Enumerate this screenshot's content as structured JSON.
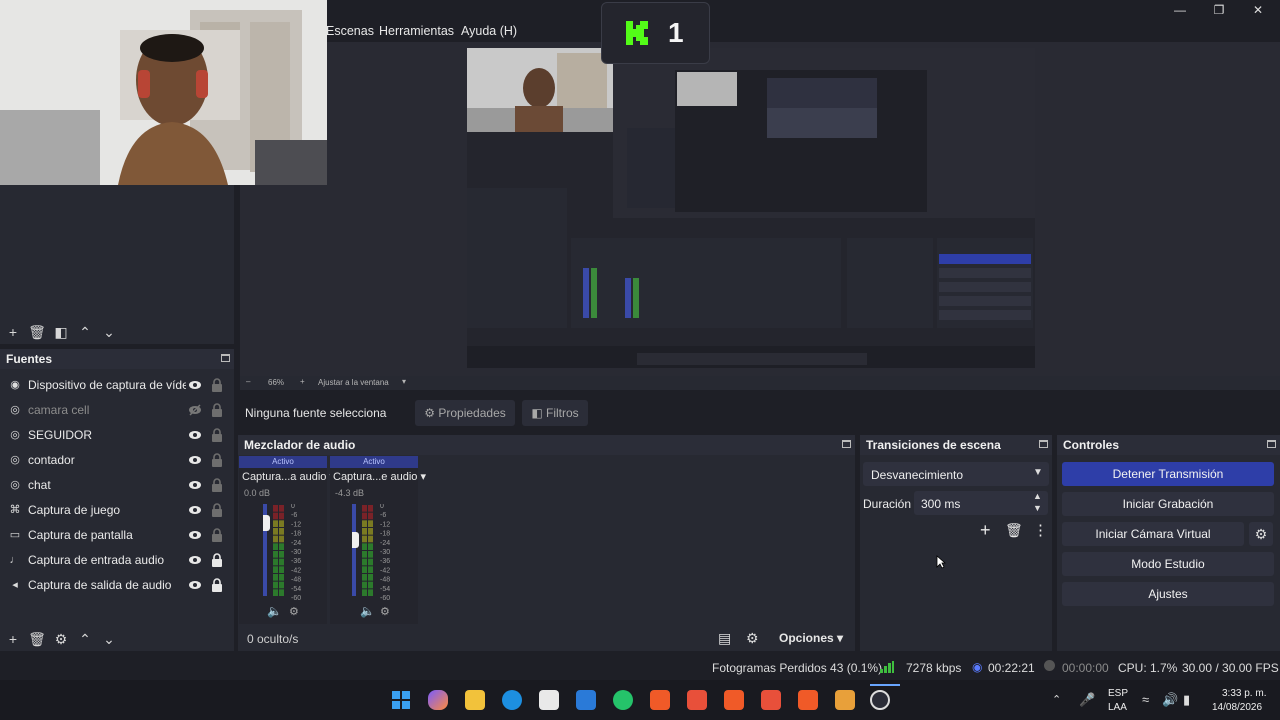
{
  "menu": {
    "items": [
      "Escenas",
      "Herramientas",
      "Ayuda (H)"
    ]
  },
  "overlay": {
    "k1_text": "1"
  },
  "preview": {
    "zoom": "66%",
    "fit_label": "Ajustar a la ventana"
  },
  "sources": {
    "title": "Fuentes",
    "items": [
      {
        "name": "Dispositivo de captura de vídeo",
        "icon": "camera-icon",
        "visible": true,
        "locked": false
      },
      {
        "name": "camara cell",
        "icon": "globe-icon",
        "visible": false,
        "locked": false
      },
      {
        "name": "SEGUIDOR",
        "icon": "globe-icon",
        "visible": true,
        "locked": false
      },
      {
        "name": "contador",
        "icon": "globe-icon",
        "visible": true,
        "locked": false
      },
      {
        "name": "chat",
        "icon": "globe-icon",
        "visible": true,
        "locked": false
      },
      {
        "name": "Captura de juego",
        "icon": "gamepad-icon",
        "visible": true,
        "locked": false
      },
      {
        "name": "Captura de pantalla",
        "icon": "monitor-icon",
        "visible": true,
        "locked": false
      },
      {
        "name": "Captura de entrada audio",
        "icon": "microphone-icon",
        "visible": true,
        "locked": true
      },
      {
        "name": "Captura de salida de audio",
        "icon": "speaker-icon",
        "visible": true,
        "locked": true
      }
    ]
  },
  "context": {
    "no_source": "Ninguna fuente selecciona",
    "properties": "Propiedades",
    "filters": "Filtros"
  },
  "mixer": {
    "title": "Mezclador de audio",
    "channels": [
      {
        "status": "Activo",
        "name": "Captura...a audio",
        "db": "0.0 dB",
        "volume": 0.88
      },
      {
        "status": "Activo",
        "name": "Captura...e audio",
        "db": "-4.3 dB",
        "volume": 0.7
      }
    ],
    "scale": [
      "0",
      "-6",
      "-12",
      "-18",
      "-24",
      "-30",
      "-36",
      "-42",
      "-48",
      "-54",
      "-60"
    ],
    "hidden": "0 oculto/s",
    "options": "Opciones"
  },
  "transitions": {
    "title": "Transiciones de escena",
    "selected": "Desvanecimiento",
    "duration_label": "Duración",
    "duration_value": "300 ms"
  },
  "controls": {
    "title": "Controles",
    "stop_stream": "Detener Transmisión",
    "start_recording": "Iniciar Grabación",
    "virtual_cam": "Iniciar Cámara Virtual",
    "studio_mode": "Modo Estudio",
    "settings": "Ajustes"
  },
  "status": {
    "dropped": "Fotogramas Perdidos 43 (0.1%)",
    "bitrate": "7278 kbps",
    "stream_time": "00:22:21",
    "rec_time": "00:00:00",
    "cpu": "CPU: 1.7%",
    "fps": "30.00 / 30.00 FPS"
  },
  "taskbar": {
    "lang1": "ESP",
    "lang2": "LAA",
    "time": "3:33 p. m.",
    "date": "14/08/2026"
  },
  "colors": {
    "accent": "#2e3ea8",
    "panel": "#272932",
    "bg": "#1e1f26"
  }
}
